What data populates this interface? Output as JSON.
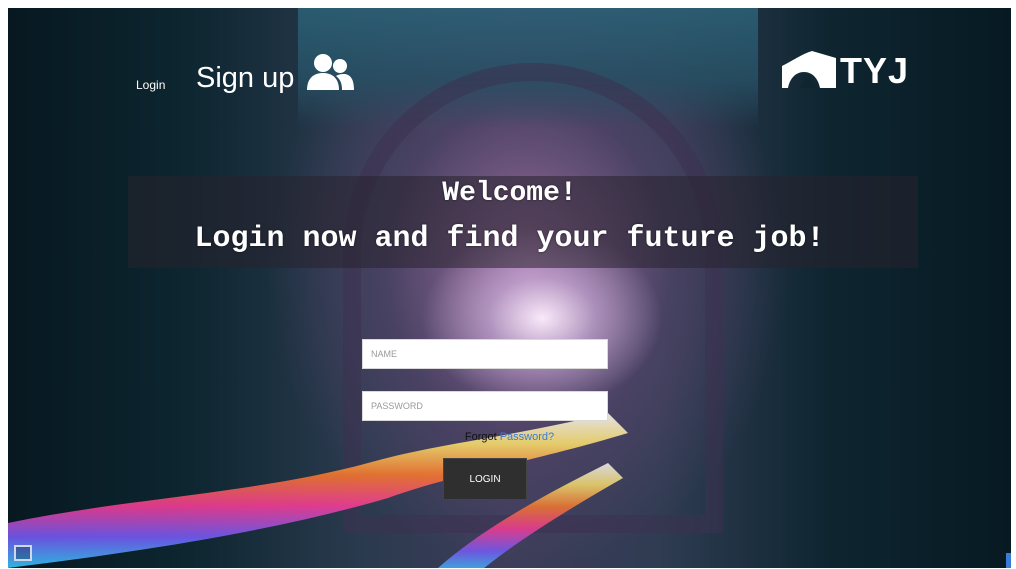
{
  "nav": {
    "login_label": "Login",
    "signup_label": "Sign up",
    "signup_icon": "users-icon"
  },
  "logo": {
    "text": "TYJ",
    "mark_icon": "bridge-logo-icon"
  },
  "hero": {
    "line1": "Welcome!",
    "line2": "Login now and find your future job!"
  },
  "form": {
    "name_placeholder": "NAME",
    "password_placeholder": "PASSWORD",
    "forgot_text": "Forgot",
    "forgot_link": "Password?",
    "submit_label": "LOGIN"
  },
  "colors": {
    "link": "#3a7bd5",
    "button": "#2f2f2f",
    "text": "#ffffff"
  }
}
